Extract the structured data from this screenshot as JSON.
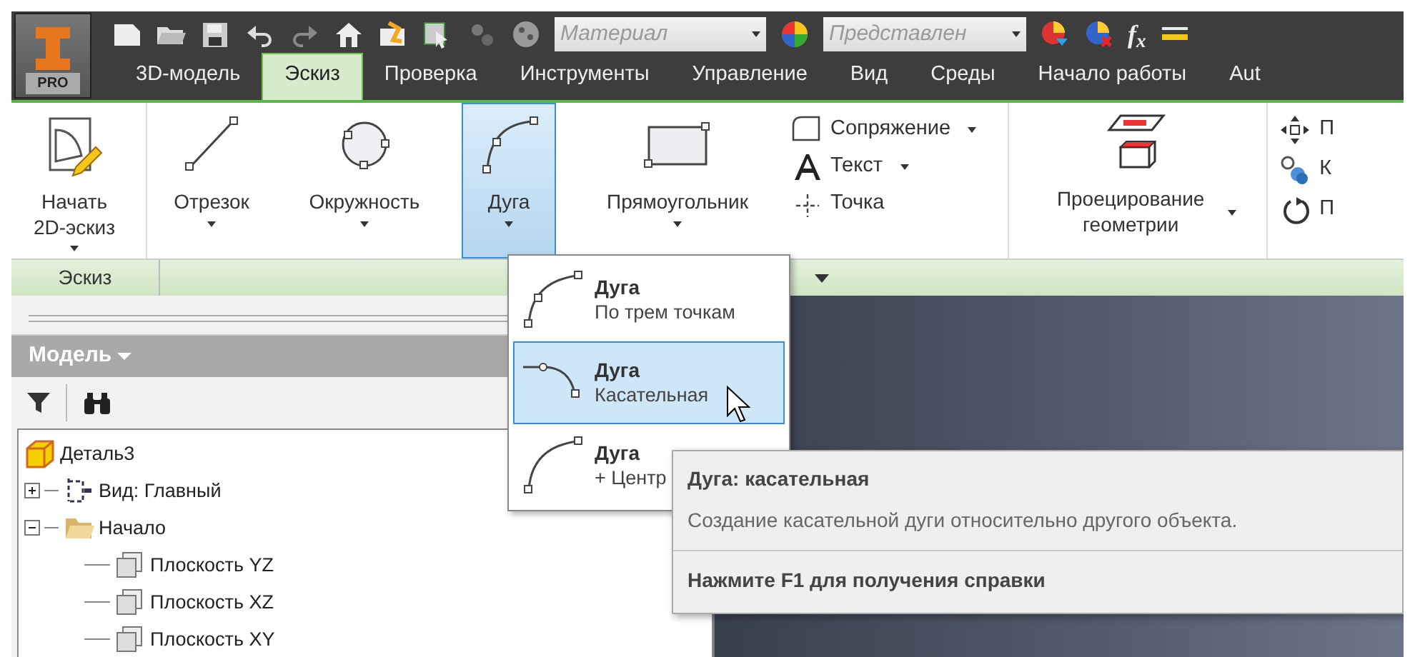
{
  "app_button": {
    "label": "PRO"
  },
  "quick_access": {
    "material": {
      "value": "Материал"
    },
    "appearance": {
      "value": "Представлен"
    },
    "formula": "f$_{x}$"
  },
  "tabs": [
    {
      "label": "3D-модель",
      "selected": false
    },
    {
      "label": "Эскиз",
      "selected": true
    },
    {
      "label": "Проверка",
      "selected": false
    },
    {
      "label": "Инструменты",
      "selected": false
    },
    {
      "label": "Управление",
      "selected": false
    },
    {
      "label": "Вид",
      "selected": false
    },
    {
      "label": "Среды",
      "selected": false
    },
    {
      "label": "Начало работы",
      "selected": false
    },
    {
      "label": "Aut",
      "selected": false
    }
  ],
  "ribbon": {
    "big_tools": [
      {
        "kind": "sketch",
        "label": "Начать 2D-эскиз",
        "selected": false
      },
      {
        "kind": "line",
        "label": "Отрезок",
        "selected": false
      },
      {
        "kind": "circle",
        "label": "Окружность",
        "selected": false
      },
      {
        "kind": "arc",
        "label": "Дуга",
        "selected": true
      },
      {
        "kind": "rectangle",
        "label": "Прямоугольник",
        "selected": false
      }
    ],
    "small_tools": [
      {
        "kind": "fillet",
        "label": "Сопряжение",
        "dropdown": true
      },
      {
        "kind": "text",
        "label": "Текст",
        "dropdown": true
      },
      {
        "kind": "point",
        "label": "Точка",
        "dropdown": false
      }
    ],
    "project_tool": {
      "label": "Проецирование геометрии"
    },
    "cut_tools": [
      {
        "kind": "move",
        "label": "П"
      },
      {
        "kind": "constraint",
        "label": "К"
      },
      {
        "kind": "rotate",
        "label": "П"
      }
    ],
    "panel_title": "Эскиз"
  },
  "browser": {
    "title": "Модель",
    "tree": [
      {
        "kind": "part",
        "label": "Деталь3",
        "children": [
          {
            "kind": "view",
            "label": "Вид: Главный",
            "expanded": false
          },
          {
            "kind": "folder",
            "label": "Начало",
            "expanded": true,
            "children": [
              {
                "kind": "plane",
                "label": "Плоскость YZ"
              },
              {
                "kind": "plane",
                "label": "Плоскость XZ"
              },
              {
                "kind": "plane",
                "label": "Плоскость XY"
              }
            ]
          }
        ]
      }
    ]
  },
  "arc_menu": {
    "items": [
      {
        "kind": "three-point",
        "title": "Дуга",
        "subtitle": "По трем точкам",
        "selected": false
      },
      {
        "kind": "tangent",
        "title": "Дуга",
        "subtitle": "Касательная",
        "selected": true
      },
      {
        "kind": "center",
        "title": "Дуга",
        "subtitle": "+ Центр",
        "selected": false
      }
    ]
  },
  "tooltip": {
    "title": "Дуга: касательная",
    "description": "Создание касательной дуги относительно другого объекта.",
    "help": "Нажмите F1 для получения справки"
  }
}
